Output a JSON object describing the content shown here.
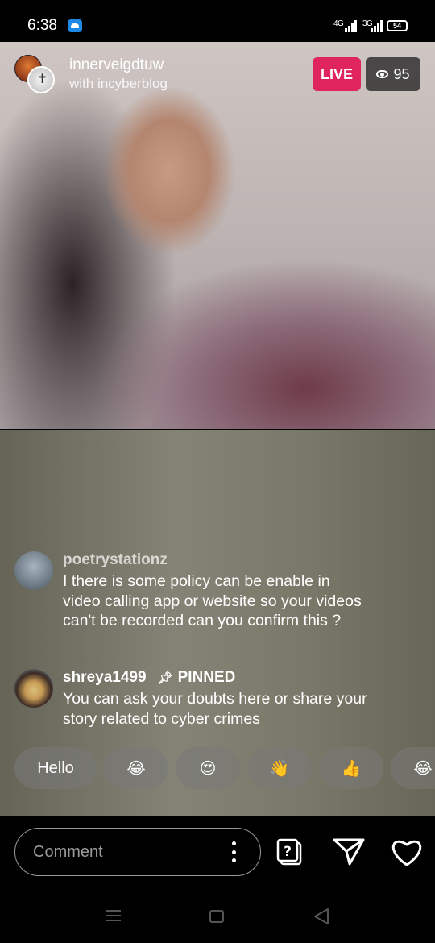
{
  "status_bar": {
    "time": "6:38",
    "network_1": "4G",
    "network_2": "3G",
    "battery": "54"
  },
  "live": {
    "host_username": "innerveigdtuw",
    "with_text": "with incyberblog",
    "live_label": "LIVE",
    "viewer_count": "95"
  },
  "comments": [
    {
      "username": "poetrystationz",
      "text": "I there is some policy can be enable in video calling app or website so your videos can't be recorded can you confirm this ?"
    },
    {
      "username": "shreya1499",
      "pinned_label": "PINNED",
      "text": "You can ask your doubts here or share your story related to cyber crimes"
    }
  ],
  "quick_reactions": [
    "Hello",
    "😂",
    "😍",
    "👋",
    "👍",
    "😂"
  ],
  "comment_bar": {
    "placeholder": "Comment"
  },
  "icons": {
    "host_avatar": "host-avatar-icon",
    "eye": "eye-icon",
    "pin": "pin-icon",
    "more": "more-options-icon",
    "questions": "question-icon",
    "share": "send-icon",
    "like": "heart-icon",
    "nav_menu": "menu-icon",
    "nav_home": "home-icon",
    "nav_back": "back-icon"
  },
  "colors": {
    "live_badge": "#e0245e",
    "app_icon": "#1e88e5"
  }
}
